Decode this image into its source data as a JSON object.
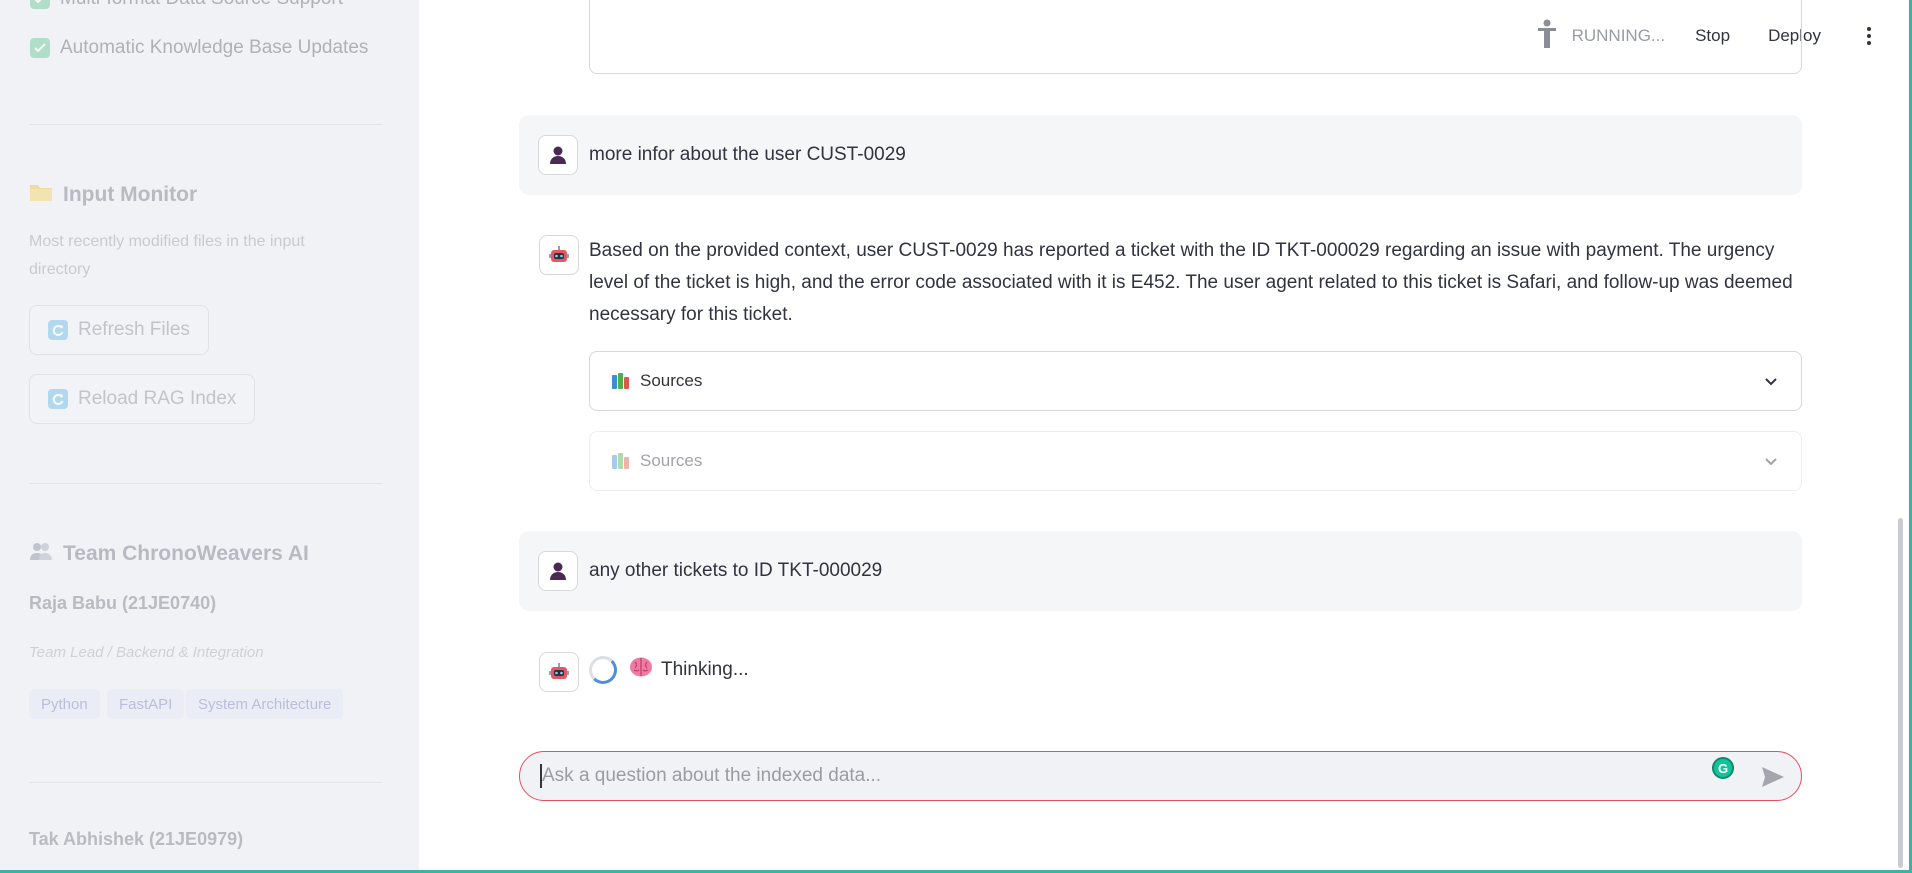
{
  "sidebar": {
    "features": [
      {
        "label": "Multi-format Data Source Support",
        "checked": true
      },
      {
        "label": "Automatic Knowledge Base Updates",
        "checked": true
      }
    ],
    "input_monitor": {
      "title": "Input Monitor",
      "caption": "Most recently modified files in the input directory",
      "refresh_button": "Refresh Files",
      "reload_button": "Reload RAG Index"
    },
    "team": {
      "title": "Team ChronoWeavers AI",
      "members": [
        {
          "name": "Raja Babu (21JE0740)",
          "role": "Team Lead / Backend & Integration",
          "tags": [
            "Python",
            "FastAPI",
            "System Architecture"
          ]
        },
        {
          "name": "Tak Abhishek (21JE0979)"
        }
      ]
    }
  },
  "header": {
    "status": "RUNNING...",
    "stop_label": "Stop",
    "deploy_label": "Deploy"
  },
  "chat": {
    "messages": [
      {
        "role": "user",
        "text": "more infor about the user CUST-0029"
      },
      {
        "role": "assistant",
        "text": "Based on the provided context, user CUST-0029 has reported a ticket with the ID TKT-000029 regarding an issue with payment. The urgency level of the ticket is high, and the error code associated with it is E452. The user agent related to this ticket is Safari, and follow-up was deemed necessary for this ticket.",
        "expanders": [
          "Sources",
          "Sources"
        ]
      },
      {
        "role": "user",
        "text": "any other tickets to ID TKT-000029"
      }
    ],
    "thinking_text": "Thinking...",
    "input_placeholder": "Ask a question about the indexed data..."
  },
  "colors": {
    "accent_red": "#e3525a",
    "sidebar_bg": "#f0f2f6",
    "frame_accent": "#3bb4a5"
  }
}
